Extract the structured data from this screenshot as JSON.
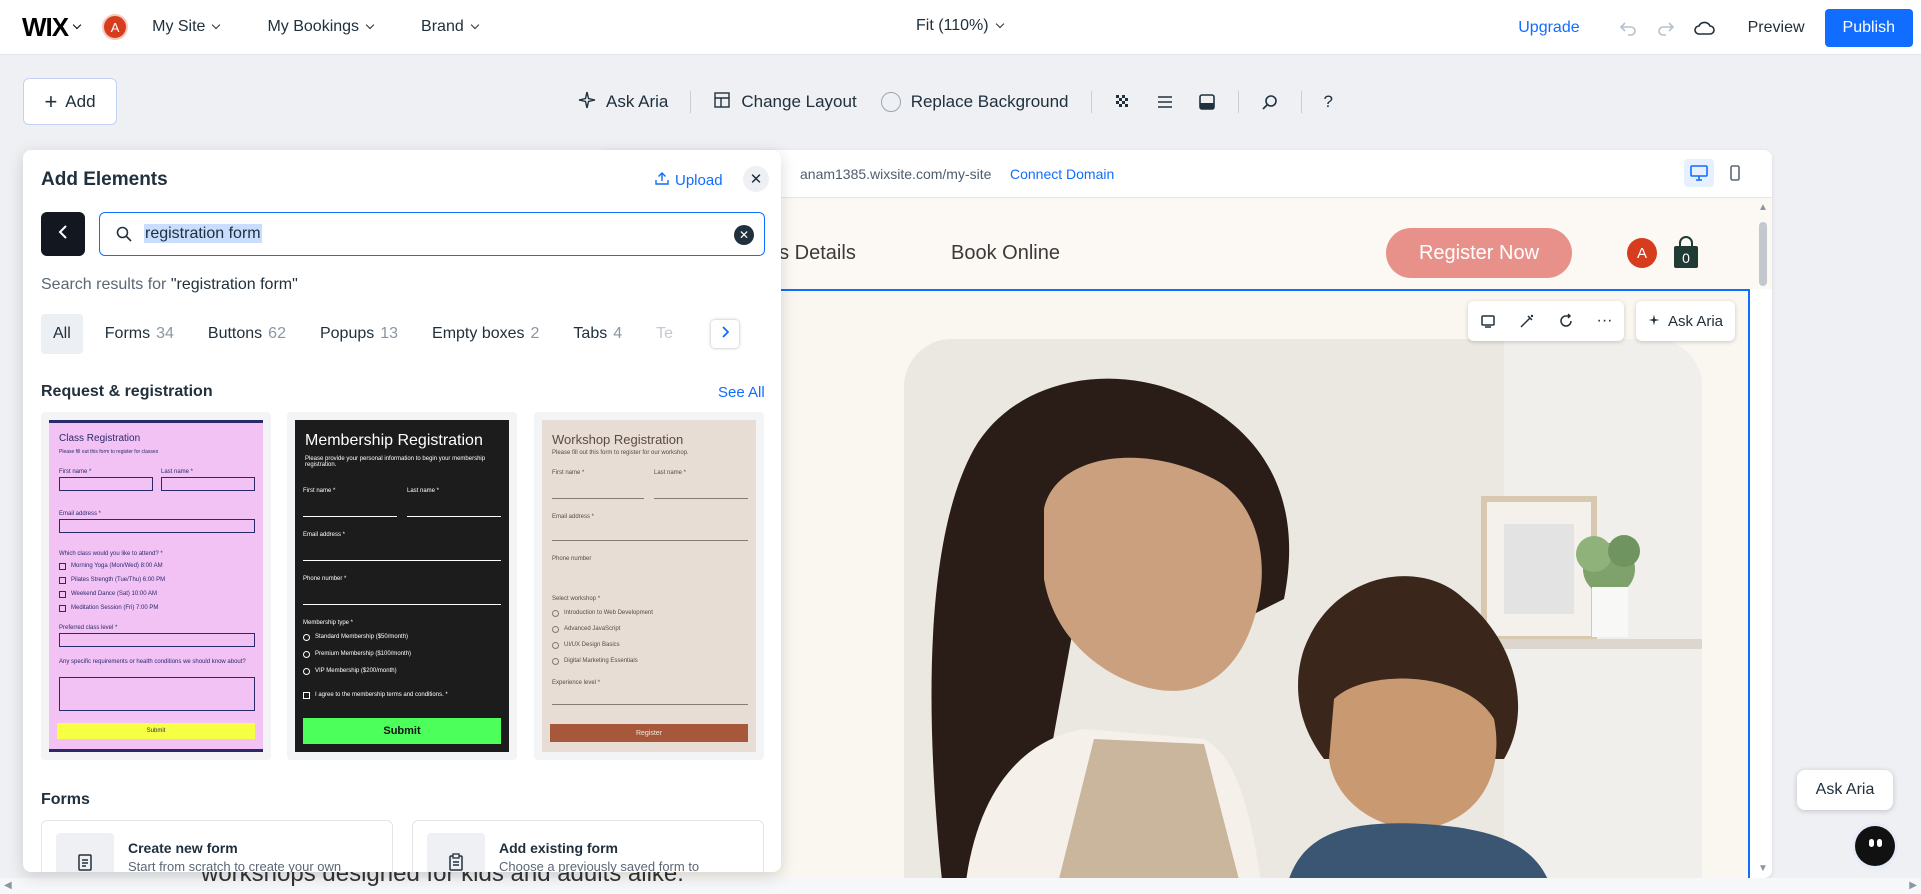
{
  "topbar": {
    "logo": "WIX",
    "avatar_letter": "A",
    "menus": [
      "My Site",
      "My Bookings",
      "Brand"
    ],
    "zoom": "Fit (110%)",
    "upgrade": "Upgrade",
    "preview": "Preview",
    "publish": "Publish"
  },
  "toolbar": {
    "add": "Add",
    "ask_aria": "Ask Aria",
    "change_layout": "Change Layout",
    "replace_background": "Replace Background",
    "help": "?"
  },
  "panel": {
    "title": "Add Elements",
    "upload": "Upload",
    "search_value": "registration form",
    "results_prefix": "Search results for ",
    "results_query": "\"registration form\"",
    "tabs": [
      {
        "label": "All",
        "count": ""
      },
      {
        "label": "Forms",
        "count": "34"
      },
      {
        "label": "Buttons",
        "count": "62"
      },
      {
        "label": "Popups",
        "count": "13"
      },
      {
        "label": "Empty boxes",
        "count": "2"
      },
      {
        "label": "Tabs",
        "count": "4"
      },
      {
        "label": "Te",
        "count": ""
      }
    ],
    "section_title": "Request & registration",
    "see_all": "See All",
    "cards": [
      {
        "title": "Class Registration",
        "subtitle": "Please fill out this form to register for classes",
        "fields": [
          "First name *",
          "Last name *",
          "Email address *",
          "Which class would you like to attend? *",
          "Morning Yoga (Mon/Wed) 8:00 AM",
          "Pilates Strength (Tue/Thu) 6:00 PM",
          "Weekend Dance (Sat) 10:00 AM",
          "Meditation Session (Fri) 7:00 PM",
          "Preferred class level *",
          "Any specific requirements or health conditions we should know about?"
        ],
        "button": "Submit",
        "bg": "#f2c2f5",
        "fg": "#2a2a6a",
        "btn_bg": "#f6ff43"
      },
      {
        "title": "Membership Registration",
        "subtitle": "Please provide your personal information to begin your membership registration.",
        "fields": [
          "First name *",
          "Last name *",
          "Email address *",
          "Phone number *",
          "Membership type *",
          "Standard Membership ($50/month)",
          "Premium Membership ($100/month)",
          "VIP Membership ($200/month)",
          "I agree to the membership terms and conditions. *"
        ],
        "button": "Submit",
        "bg": "#1c1c1c",
        "fg": "#ffffff",
        "btn_bg": "#4cff5a"
      },
      {
        "title": "Workshop Registration",
        "subtitle": "Please fill out this form to register for our workshop.",
        "fields": [
          "First name *",
          "Last name *",
          "Email address *",
          "Phone number",
          "Select workshop *",
          "Introduction to Web Development",
          "Advanced JavaScript",
          "UI/UX Design Basics",
          "Digital Marketing Essentials",
          "Experience level *"
        ],
        "button": "Register",
        "bg": "#e8ddd4",
        "fg": "#5b4a3f",
        "btn_bg": "#a7583a"
      }
    ],
    "forms_title": "Forms",
    "form_options": [
      {
        "title": "Create new form",
        "subtitle": "Start from scratch to create your own"
      },
      {
        "title": "Add existing form",
        "subtitle": "Choose a previously saved form to"
      }
    ]
  },
  "canvas": {
    "url": "anam1385.wixsite.com/my-site",
    "connect_domain": "Connect Domain",
    "nav": [
      "ass Details",
      "Book Online"
    ],
    "register_now": "Register Now",
    "avatar_letter": "A",
    "cart_count": "0",
    "ask_aria": "Ask Aria",
    "hero_text": "workshops designed for kids and adults alike."
  },
  "floating": {
    "ask_aria": "Ask Aria"
  },
  "colors": {
    "accent": "#116dff",
    "register_bg": "#e8918a",
    "avatar_red": "#d63d1f"
  }
}
